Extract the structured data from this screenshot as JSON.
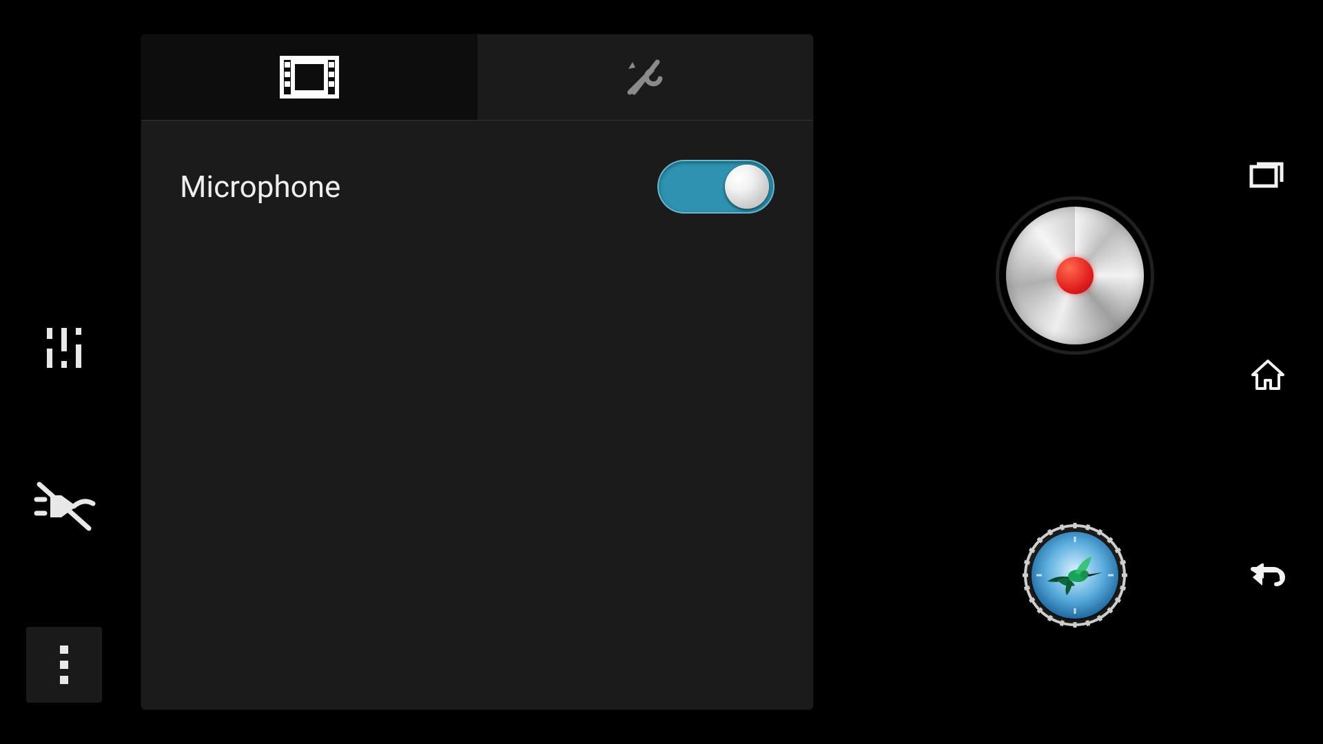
{
  "tabs": {
    "video_icon": "film-icon",
    "tools_icon": "tools-icon",
    "active_index": 0
  },
  "settings": {
    "microphone": {
      "label": "Microphone",
      "value": true
    }
  },
  "left_strip": {
    "sliders_icon": "adjustments-icon",
    "flash_icon": "flash-off-icon",
    "menu_icon": "more-menu-icon"
  },
  "controls": {
    "record_icon": "record-button",
    "mode_icon": "timeshift-mode",
    "gallery_subject": "hummingbird"
  },
  "navbar": {
    "recent": "recent-apps-icon",
    "home": "home-icon",
    "back": "back-icon"
  },
  "colors": {
    "toggle_on": "#2f92b0",
    "record_red": "#e21f1f",
    "panel_bg": "#1b1b1b"
  }
}
